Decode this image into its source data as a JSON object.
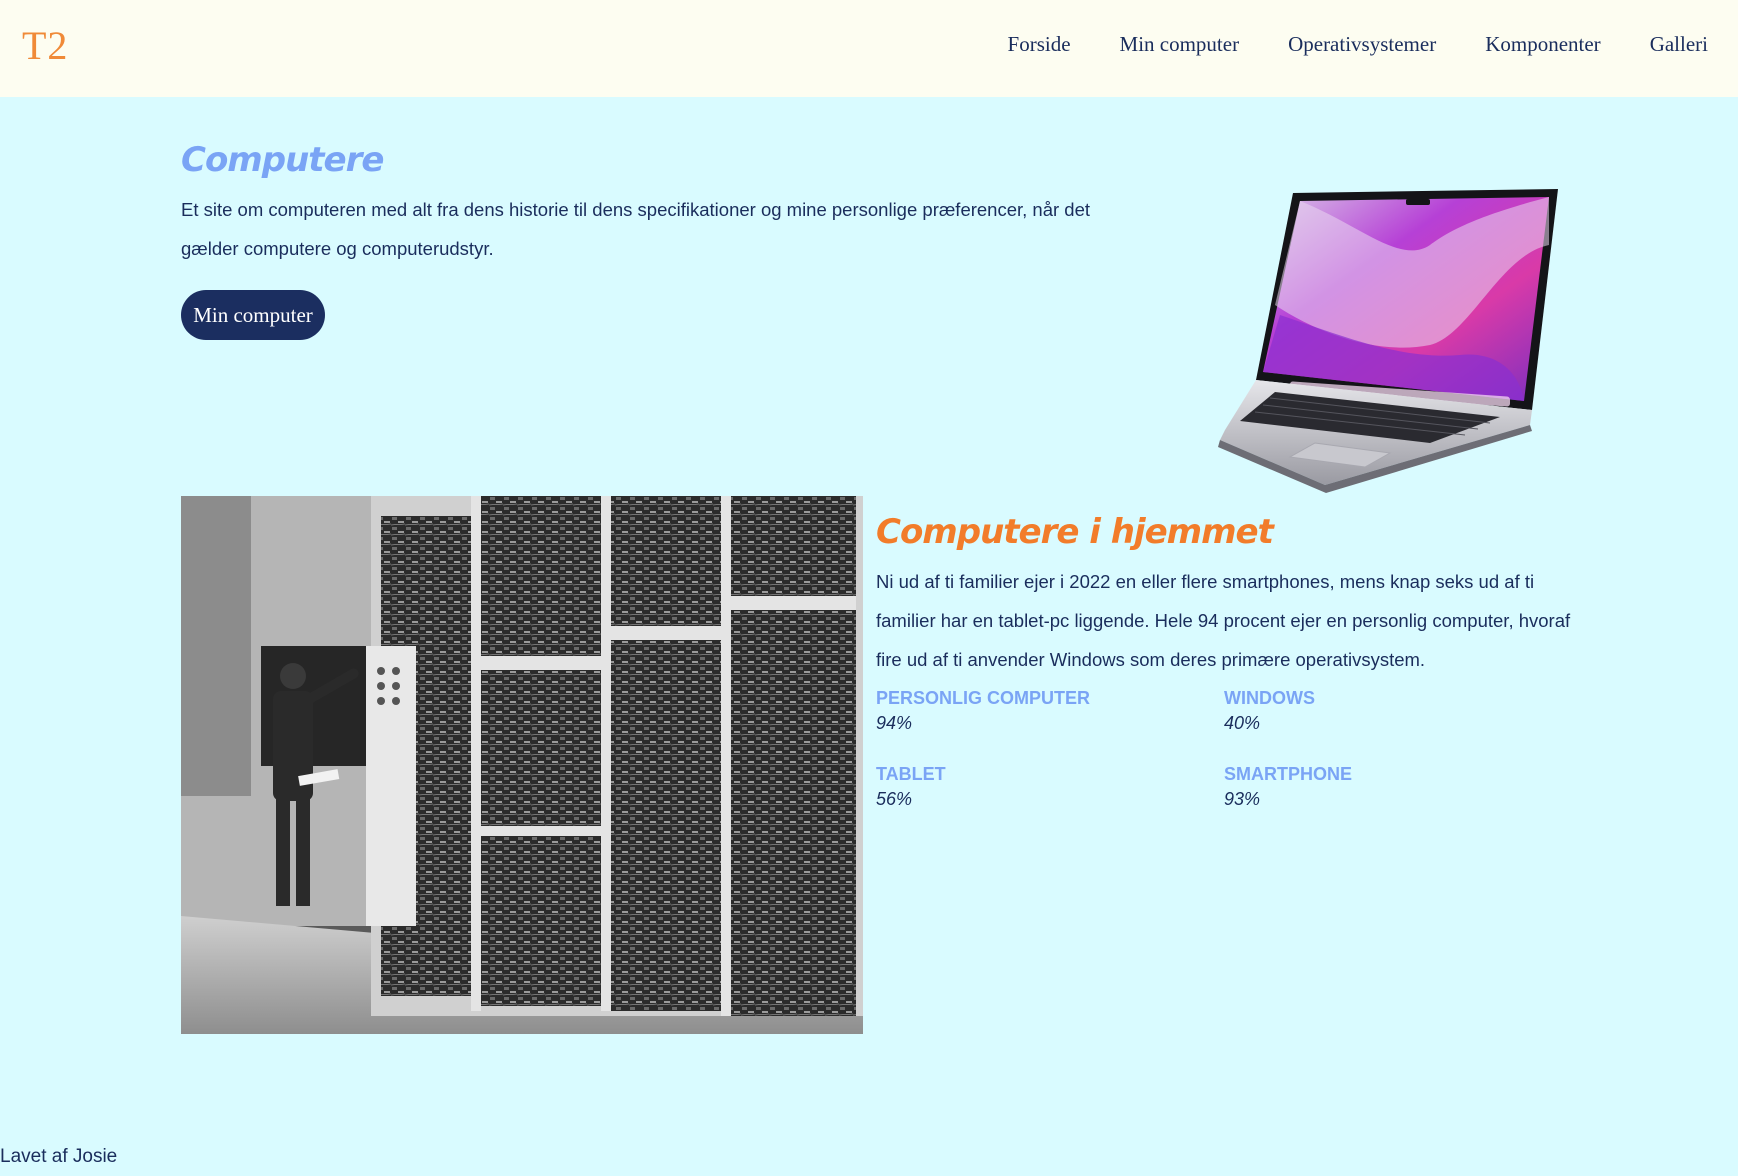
{
  "header": {
    "logo": "T2",
    "nav": [
      "Forside",
      "Min computer",
      "Operativsystemer",
      "Komponenter",
      "Galleri"
    ]
  },
  "hero": {
    "title": "Computere",
    "text": "Et site om computeren med alt fra dens historie til dens specifikationer og mine personlige præferencer, når det gælder computere og computerudstyr.",
    "button": "Min computer"
  },
  "home": {
    "title": "Computere i hjemmet",
    "text": "Ni ud af ti familier ejer i 2022 en eller flere smartphones, mens knap seks ud af ti familier har en tablet-pc liggende. Hele 94 procent ejer en personlig computer, hvoraf fire ud af ti anvender Windows som deres primære operativsystem.",
    "stats": [
      {
        "label": "PERSONLIG COMPUTER",
        "value": "94%"
      },
      {
        "label": "WINDOWS",
        "value": "40%"
      },
      {
        "label": "TABLET",
        "value": "56%"
      },
      {
        "label": "SMARTPHONE",
        "value": "93%"
      }
    ]
  },
  "footer": {
    "text": "Lavet af Josie"
  },
  "colors": {
    "background": "#d9fbff",
    "header_bg": "#fdfdf1",
    "logo": "#f08a38",
    "navy": "#1b2e60",
    "blue_accent": "#7aa4f5",
    "orange_accent": "#f27c2a"
  }
}
